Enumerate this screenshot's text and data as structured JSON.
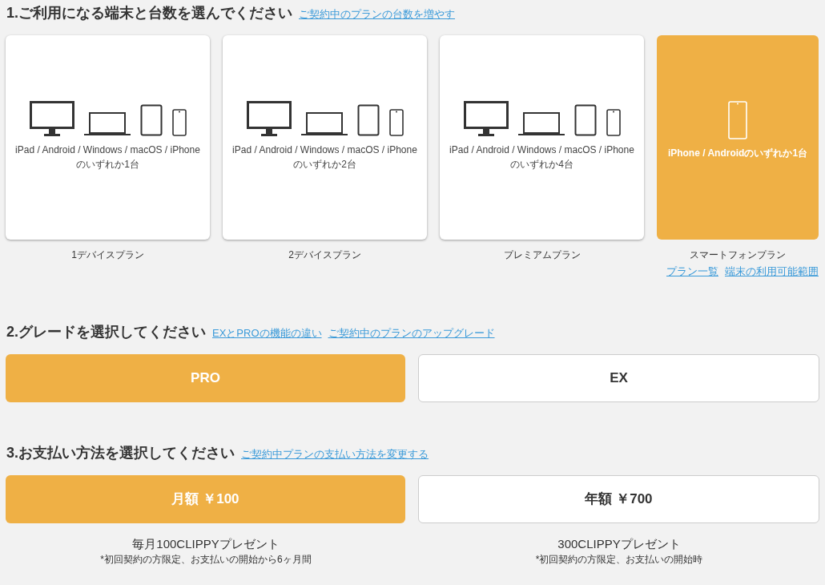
{
  "step1": {
    "title": "1.ご利用になる端末と台数を選んでください",
    "links": [
      "ご契約中のプランの台数を増やす"
    ],
    "plans": [
      {
        "kind": "all",
        "description": "iPad / Android / Windows / macOS / iPhoneのいずれか1台",
        "name": "1デバイスプラン",
        "selected": false
      },
      {
        "kind": "all",
        "description": "iPad / Android / Windows / macOS / iPhoneのいずれか2台",
        "name": "2デバイスプラン",
        "selected": false
      },
      {
        "kind": "all",
        "description": "iPad / Android / Windows / macOS / iPhoneのいずれか4台",
        "name": "プレミアムプラン",
        "selected": false
      },
      {
        "kind": "phone",
        "description": "iPhone / Androidのいずれか1台",
        "name": "スマートフォンプラン",
        "selected": true
      }
    ],
    "footer_links": [
      "プラン一覧",
      "端末の利用可能範囲"
    ]
  },
  "step2": {
    "title": "2.グレードを選択してください",
    "links": [
      "EXとPROの機能の違い",
      "ご契約中のプランのアップグレード"
    ],
    "options": [
      {
        "label": "PRO",
        "selected": true
      },
      {
        "label": "EX",
        "selected": false
      }
    ]
  },
  "step3": {
    "title": "3.お支払い方法を選択してください",
    "links": [
      "ご契約中プランの支払い方法を変更する"
    ],
    "options": [
      {
        "label": "月額 ￥100",
        "selected": true,
        "note": "毎月100CLIPPYプレゼント",
        "fine_print": "*初回契約の方限定、お支払いの開始から6ヶ月間"
      },
      {
        "label": "年額 ￥700",
        "selected": false,
        "note": "300CLIPPYプレゼント",
        "fine_print": "*初回契約の方限定、お支払いの開始時"
      }
    ]
  }
}
